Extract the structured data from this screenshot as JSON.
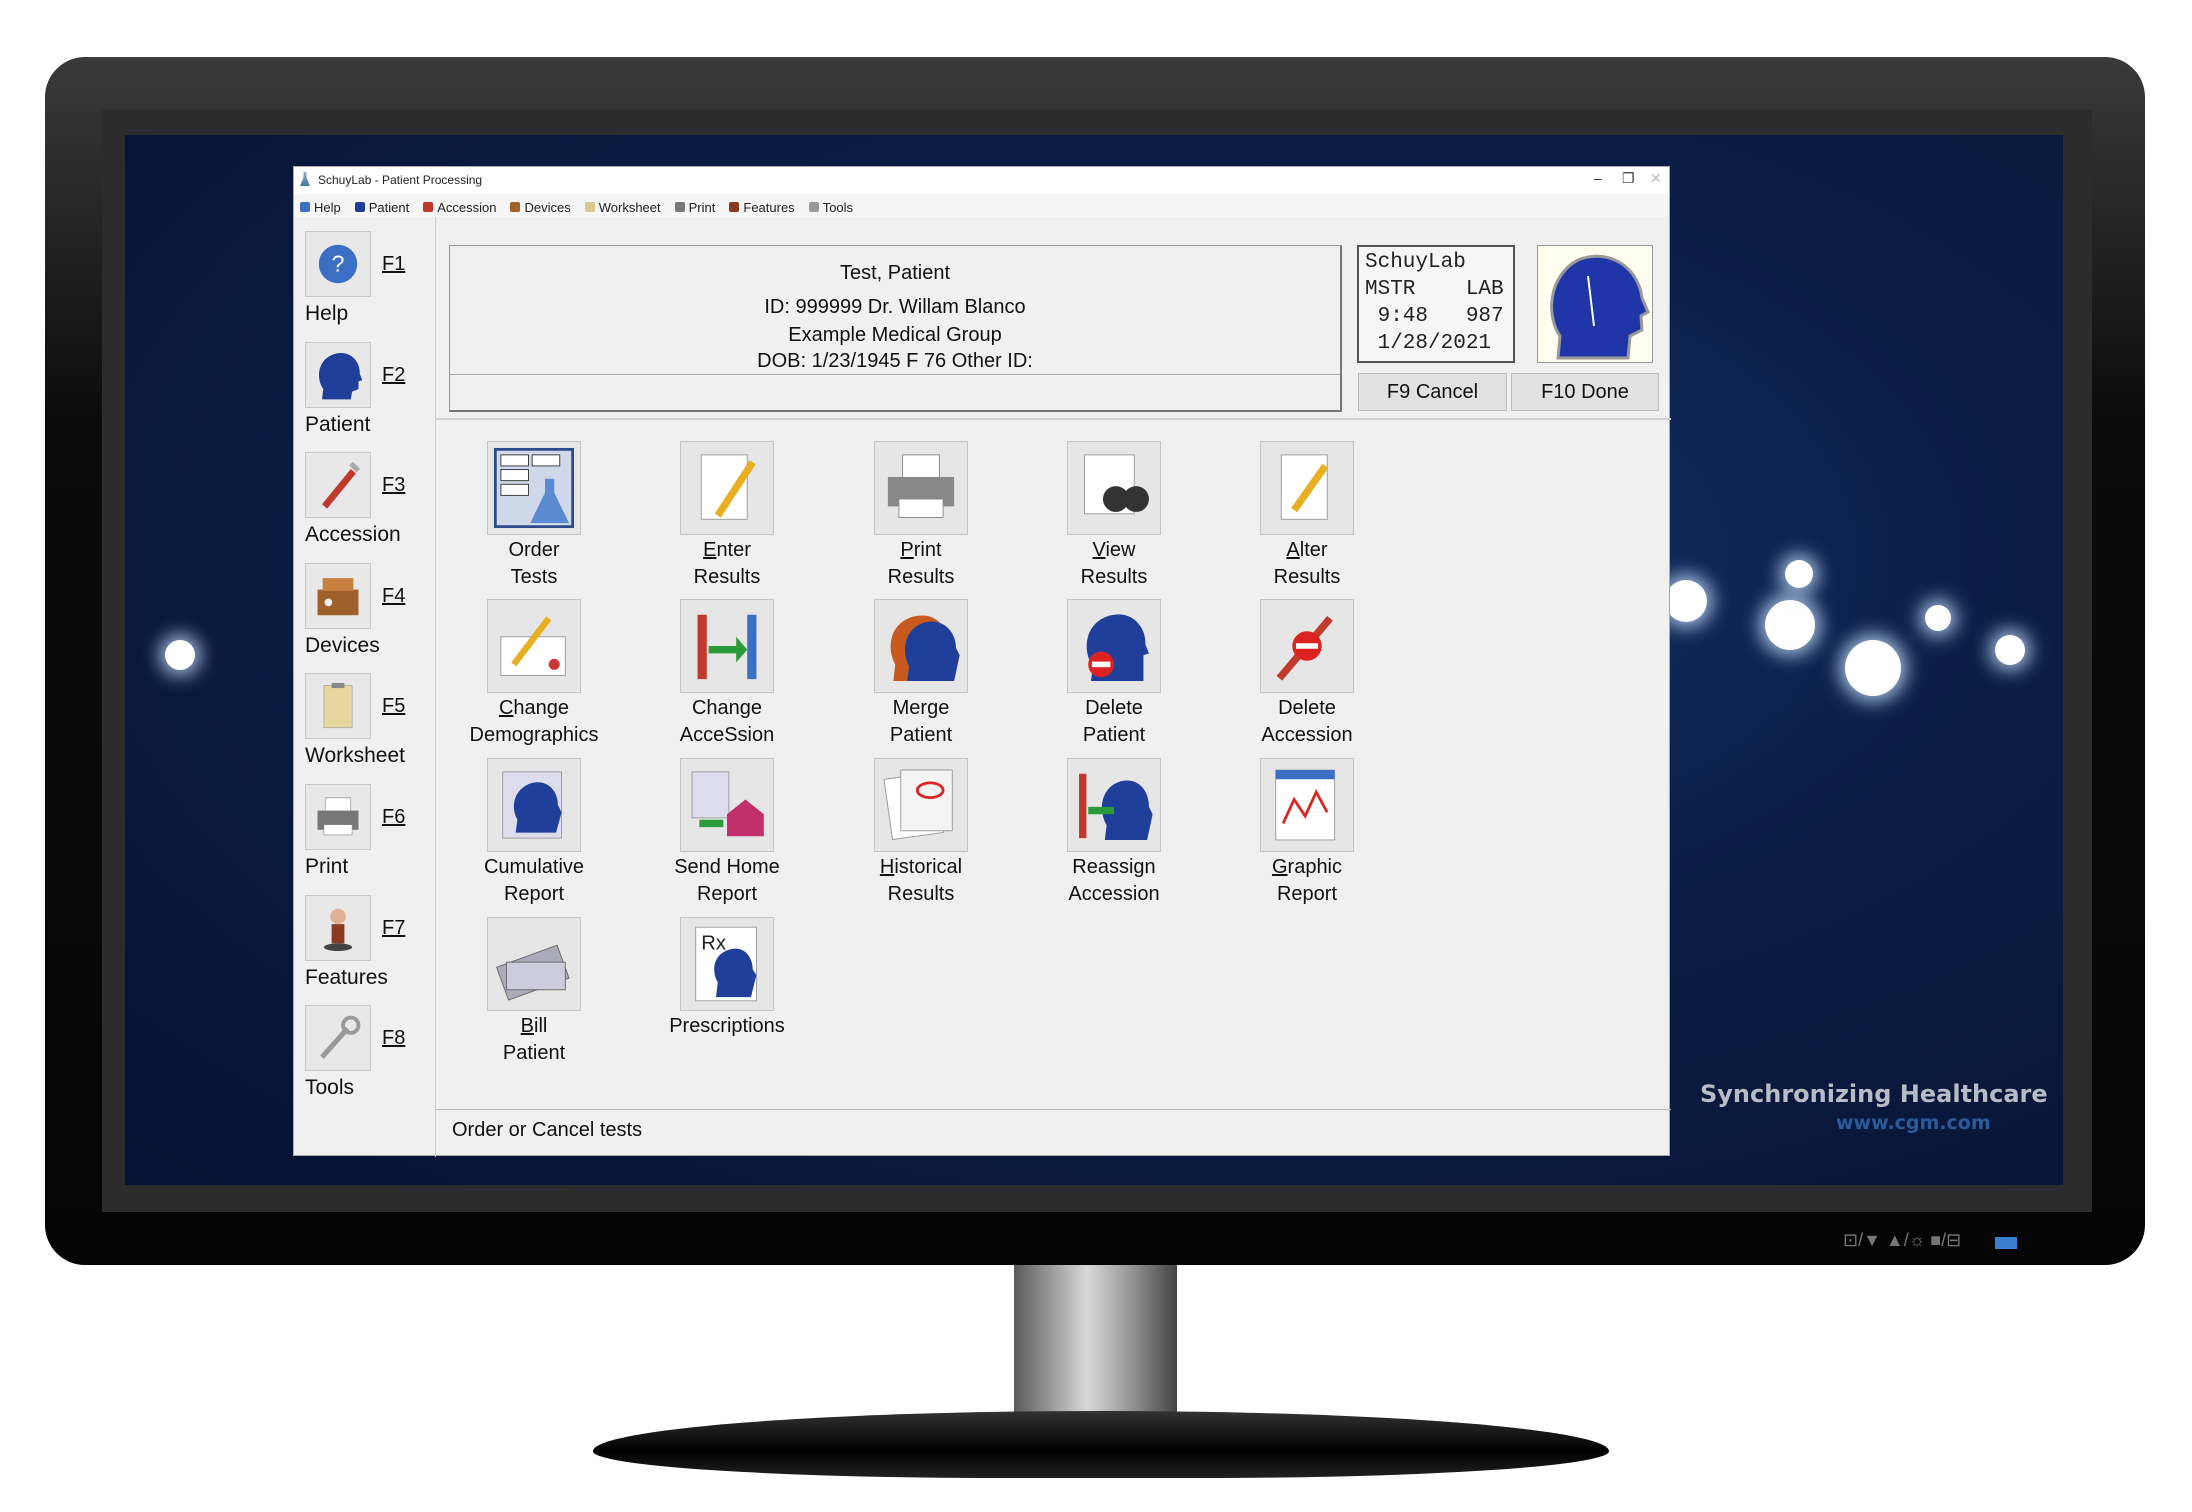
{
  "window": {
    "title": "SchuyLab - Patient Processing",
    "minimize": "–",
    "restore": "❐",
    "close": "✕"
  },
  "menu": [
    {
      "label": "Help",
      "icon": "help-icon",
      "color": "#3a6fc4"
    },
    {
      "label": "Patient",
      "icon": "patient-head-icon",
      "color": "#1f3f9a"
    },
    {
      "label": "Accession",
      "icon": "test-tube-icon",
      "color": "#c0392b"
    },
    {
      "label": "Devices",
      "icon": "devices-icon",
      "color": "#a0602a"
    },
    {
      "label": "Worksheet",
      "icon": "clipboard-icon",
      "color": "#d8c890"
    },
    {
      "label": "Print",
      "icon": "printer-icon",
      "color": "#777777"
    },
    {
      "label": "Features",
      "icon": "features-icon",
      "color": "#8a3a20"
    },
    {
      "label": "Tools",
      "icon": "wrench-icon",
      "color": "#999999"
    }
  ],
  "sidebar": [
    {
      "key": "F1",
      "label": "Help",
      "icon": "help-icon"
    },
    {
      "key": "F2",
      "label": "Patient",
      "icon": "patient-head-icon"
    },
    {
      "key": "F3",
      "label": "Accession",
      "icon": "test-tube-icon"
    },
    {
      "key": "F4",
      "label": "Devices",
      "icon": "devices-icon"
    },
    {
      "key": "F5",
      "label": "Worksheet",
      "icon": "clipboard-icon"
    },
    {
      "key": "F6",
      "label": "Print",
      "icon": "printer-icon"
    },
    {
      "key": "F7",
      "label": "Features",
      "icon": "features-icon"
    },
    {
      "key": "F8",
      "label": "Tools",
      "icon": "wrench-icon"
    }
  ],
  "patient": {
    "name": "Test, Patient",
    "id_line": "ID: 999999 Dr. Willam Blanco",
    "group": "Example Medical Group",
    "dob_line": "DOB:  1/23/1945 F 76   Other ID:"
  },
  "lab_box": {
    "line1": "SchuyLab",
    "line2": "MSTR    LAB",
    "line3": " 9:48   987",
    "line4": " 1/28/2021"
  },
  "buttons": {
    "cancel": "F9 Cancel",
    "done": "F10 Done"
  },
  "actions": [
    {
      "l1": "Order",
      "l2": "Tests",
      "u": -1,
      "icon": "order-tests-icon"
    },
    {
      "l1": "Enter",
      "l2": "Results",
      "u": 0,
      "icon": "enter-results-icon"
    },
    {
      "l1": "Print",
      "l2": "Results",
      "u": 0,
      "icon": "print-results-icon"
    },
    {
      "l1": "View",
      "l2": "Results",
      "u": 0,
      "icon": "view-results-icon"
    },
    {
      "l1": "Alter",
      "l2": "Results",
      "u": 0,
      "icon": "alter-results-icon"
    },
    {
      "l1": "Change",
      "l2": "Demographics",
      "u": 0,
      "icon": "change-demographics-icon"
    },
    {
      "l1": "Change",
      "l2": "AcceSsion",
      "u": -1,
      "icon": "change-accession-icon"
    },
    {
      "l1": "Merge",
      "l2": "Patient",
      "u": -1,
      "icon": "merge-patient-icon"
    },
    {
      "l1": "Delete",
      "l2": "Patient",
      "u": -1,
      "icon": "delete-patient-icon"
    },
    {
      "l1": "Delete",
      "l2": "Accession",
      "u": -1,
      "icon": "delete-accession-icon"
    },
    {
      "l1": "Cumulative",
      "l2": "Report",
      "u": -1,
      "icon": "cumulative-report-icon"
    },
    {
      "l1": "Send Home",
      "l2": "Report",
      "u": -1,
      "icon": "send-home-report-icon"
    },
    {
      "l1": "Historical",
      "l2": "Results",
      "u": 0,
      "icon": "historical-results-icon"
    },
    {
      "l1": "Reassign",
      "l2": "Accession",
      "u": -1,
      "icon": "reassign-accession-icon"
    },
    {
      "l1": "Graphic",
      "l2": "Report",
      "u": 0,
      "icon": "graphic-report-icon"
    },
    {
      "l1": "Bill",
      "l2": "Patient",
      "u": 0,
      "icon": "bill-patient-icon"
    },
    {
      "l1": "Prescriptions",
      "l2": "",
      "u": -1,
      "icon": "prescriptions-icon"
    }
  ],
  "status": "Order or Cancel tests",
  "branding": {
    "tagline": "Synchronizing Healthcare",
    "url": "www.cgm.com"
  },
  "monitor_controls": "⊡/▼  ▲/☼ ■/⊟"
}
